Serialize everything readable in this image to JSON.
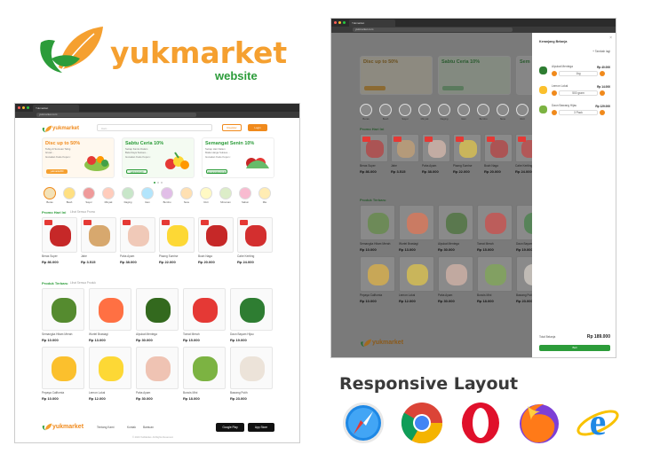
{
  "brand": {
    "name": "yukmarket",
    "subtitle": "website",
    "green": "#2c9c3a",
    "orange": "#f5a030"
  },
  "headline": "Responsive Layout",
  "browsers": [
    "safari-icon",
    "chrome-icon",
    "opera-icon",
    "firefox-icon",
    "ie-icon"
  ],
  "left_screen": {
    "tab_title": "Yukmarket",
    "url": "yukmarket.com",
    "search_placeholder": "Cari...",
    "register_label": "Register",
    "login_label": "Login",
    "promos": [
      {
        "title": "Disc up to 50%",
        "desc": "Tebig di Sumuan Tebig Grosir...",
        "code_label": "Gunakan Kode Kupon :",
        "code": "yukmarket50"
      },
      {
        "title": "Sabtu Ceria 10%",
        "desc": "Setiap Kamis Dalam Bela Daya Sukses...",
        "code_label": "Gunakan Kode Kupon :",
        "code": "sabtuceria10"
      },
      {
        "title": "Semangat Senin 10%",
        "desc": "Setiap Hari Dalam Maka Harga Sukses...",
        "code_label": "Gunakan Kode Kupon :",
        "code": "semangatsenin10"
      }
    ],
    "categories": [
      "Beras",
      "Buah",
      "Sayur",
      "Minyak",
      "Daging",
      "Ikan",
      "Bumbu",
      "Susu",
      "Roti",
      "Minuman",
      "Sabun",
      "Mie"
    ],
    "section_promo": "Promo Hari Ini",
    "section_promo_link": "Lihat Semua Promo",
    "section_products": "Produk Terbaru",
    "section_products_link": "Lihat Semua Produk",
    "promo_items": [
      {
        "name": "Beras Super",
        "price": "Rp 86.000"
      },
      {
        "name": "Jahe",
        "price": "Rp 3.515"
      },
      {
        "name": "Paha Ayam",
        "price": "Rp 38.000"
      },
      {
        "name": "Pisang Sunrise",
        "price": "Rp 22.000"
      },
      {
        "name": "Buah Naga",
        "price": "Rp 20.000"
      },
      {
        "name": "Cabe Keriting",
        "price": "Rp 24.000"
      }
    ],
    "products": [
      {
        "name": "Semangka Hitam Merah",
        "price": "Rp 10.000"
      },
      {
        "name": "Wortel Brastagi",
        "price": "Rp 13.000"
      },
      {
        "name": "Alpukat Mentega",
        "price": "Rp 30.000"
      },
      {
        "name": "Tomat Merah",
        "price": "Rp 15.000"
      },
      {
        "name": "Daun Bayam Hijau",
        "price": "Rp 19.000"
      },
      {
        "name": "Pepaya California",
        "price": "Rp 10.000"
      },
      {
        "name": "Lemon Lokal",
        "price": "Rp 12.000"
      },
      {
        "name": "Paha Ayam",
        "price": "Rp 30.000"
      },
      {
        "name": "Buncis Mini",
        "price": "Rp 18.000"
      },
      {
        "name": "Bawang Putih",
        "price": "Rp 23.000"
      }
    ],
    "footer_links": [
      "Tentang Kami",
      "Kontak",
      "Bantuan"
    ],
    "copyright": "© 2020 YukMarket. All Rights Reserved.",
    "google_play": "Google Play",
    "app_store": "App Store"
  },
  "right_screen": {
    "promos": [
      "Disc up to 50%",
      "Sabtu Ceria 10%",
      "Sem"
    ],
    "section_promo": "Promo Hari Ini",
    "section_products": "Produk Terbaru",
    "cart_title": "Keranjang Belanja",
    "cart_add": "Tambah lagi",
    "cart_items": [
      {
        "name": "Alpukat Mentega",
        "qty": "1kg",
        "price": "Rp 40.000"
      },
      {
        "name": "Lemon Lokal",
        "qty": "500 gram",
        "price": "Rp 14.000"
      },
      {
        "name": "Daun Bawang Hijau",
        "qty": "3 Pack",
        "price": "Rp 129.000"
      }
    ],
    "total_label": "Total Belanja",
    "total_value": "Rp 189.000",
    "checkout_label": "Beli"
  }
}
